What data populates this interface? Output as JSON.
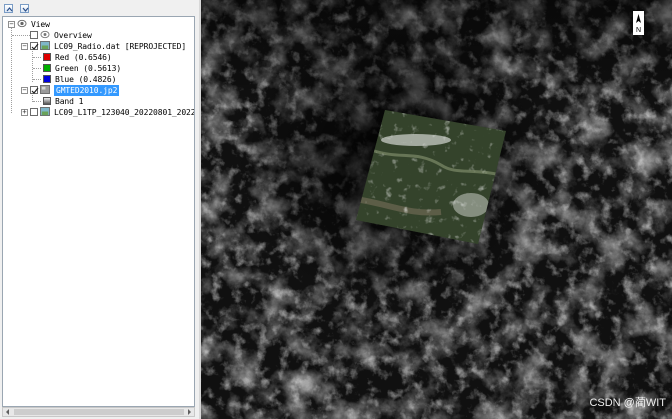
{
  "toolbar": {
    "buttons": [
      {
        "icon": "collapse-up-icon"
      },
      {
        "icon": "expand-down-icon"
      }
    ]
  },
  "tree": {
    "root_label": "View",
    "overview_label": "Overview",
    "layer1": {
      "name": "LC09_Radio.dat [REPROJECTED]",
      "bands": [
        {
          "label": "Red (0.6546)",
          "color": "#e00000"
        },
        {
          "label": "Green (0.5613)",
          "color": "#00b000"
        },
        {
          "label": "Blue (0.4826)",
          "color": "#0000e0"
        }
      ]
    },
    "layer2": {
      "name": "GMTED2010.jp2",
      "band": "Band 1"
    },
    "layer3": {
      "name": "LC09_L1TP_123040_20220801_20220801_"
    }
  },
  "map": {
    "north_label": "N"
  },
  "watermark": "CSDN @蔺WIT"
}
